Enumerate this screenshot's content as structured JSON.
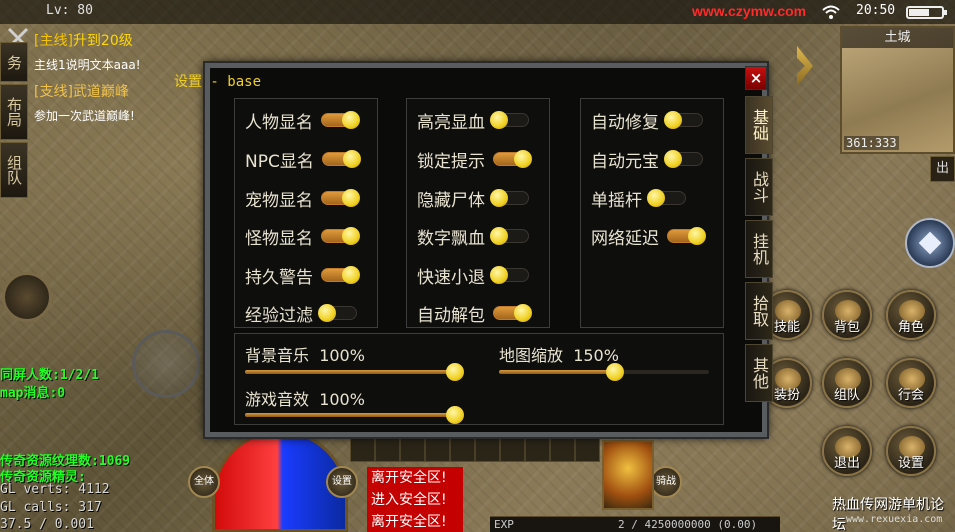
{
  "status_bar": {
    "level": "Lv: 80",
    "site": "www.czymw.com",
    "time": "20:50"
  },
  "left_tabs": [
    "务",
    "布局",
    "组队"
  ],
  "quests": {
    "main_tag": "[主线]",
    "main_title": "升到20级",
    "main_desc": "主线1说明文本aaa!",
    "side_tag": "[支线]",
    "side_title": "武道巅峰",
    "side_desc": "参加一次武道巅峰!"
  },
  "stats": {
    "screen_players": "同屏人数:1/2/1",
    "map_msg": "map消息:0",
    "texture_count": "传奇资源纹理数:1069",
    "sprite_label": "传奇资源精灵:",
    "gl_verts": "GL verts:  4112",
    "gl_calls": "GL calls:   317",
    "fps": "37.5 / 0.001"
  },
  "minimap": {
    "title": "土城",
    "coords": "361:333",
    "exit_label": "出"
  },
  "dialog": {
    "title": "设置 - base",
    "close": "×",
    "columns": [
      {
        "items": [
          {
            "label": "人物显名",
            "on": true
          },
          {
            "label": "NPC显名",
            "on": true
          },
          {
            "label": "宠物显名",
            "on": true
          },
          {
            "label": "怪物显名",
            "on": true
          },
          {
            "label": "持久警告",
            "on": true
          },
          {
            "label": "经验过滤",
            "on": false
          }
        ]
      },
      {
        "items": [
          {
            "label": "高亮显血",
            "on": false
          },
          {
            "label": "锁定提示",
            "on": true
          },
          {
            "label": "隐藏尸体",
            "on": false
          },
          {
            "label": "数字飘血",
            "on": false
          },
          {
            "label": "快速小退",
            "on": false
          },
          {
            "label": "自动解包",
            "on": true
          }
        ]
      },
      {
        "items": [
          {
            "label": "自动修复",
            "on": false
          },
          {
            "label": "自动元宝",
            "on": false
          },
          {
            "label": "单摇杆",
            "on": false
          },
          {
            "label": "网络延迟",
            "on": true
          }
        ]
      }
    ],
    "sliders": [
      {
        "label": "背景音乐",
        "value": "100%",
        "fraction": 1.0
      },
      {
        "label": "地图缩放",
        "value": "150%",
        "fraction": 0.5
      },
      {
        "label": "游戏音效",
        "value": "100%",
        "fraction": 1.0
      }
    ],
    "side_tabs": [
      "基础",
      "战斗",
      "挂机",
      "拾取",
      "其他"
    ]
  },
  "action_buttons": [
    "技能",
    "背包",
    "角色",
    "装扮",
    "组队",
    "行会",
    "退出",
    "设置"
  ],
  "orb_buttons": [
    "全体",
    "设置",
    "骑战"
  ],
  "safe_zone_msgs": [
    "离开安全区!",
    "进入安全区!",
    "离开安全区!"
  ],
  "exp": {
    "label": "EXP",
    "value": "2 / 4250000000 (0.00)"
  },
  "watermark": {
    "title": "热血传网游单机论坛",
    "url": "www.rexuexia.com"
  }
}
